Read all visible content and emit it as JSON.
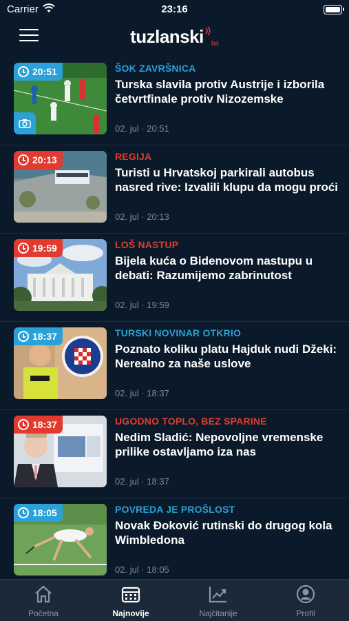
{
  "status_bar": {
    "carrier": "Carrier",
    "time": "23:16",
    "battery_level": 1.0
  },
  "header": {
    "logo_text": "tuzlanski",
    "logo_suffix": "ba",
    "menu_icon": "hamburger-menu-icon"
  },
  "colors": {
    "background": "#0b1a2a",
    "accent_blue": "#2aa1d8",
    "accent_red": "#e23a2e",
    "muted_text": "#7c8896",
    "tabbar_bg": "#1b2938"
  },
  "articles": [
    {
      "time": "20:51",
      "category": "ŠOK ZAVRŠNICA",
      "category_color": "#2aa1d8",
      "badge_color": "#2aa1d8",
      "title": "Turska slavila protiv Austrije i izborila četvrtfinale protiv Nizozemske",
      "meta": "02. jul · 20:51",
      "gallery": true
    },
    {
      "time": "20:13",
      "category": "REGIJA",
      "category_color": "#e23a2e",
      "badge_color": "#e23a2e",
      "title": "Turisti u Hrvatskoj parkirali autobus nasred rive: Izvalili klupu da mogu proći",
      "meta": "02. jul · 20:13",
      "gallery": false
    },
    {
      "time": "19:59",
      "category": "LOŠ NASTUP",
      "category_color": "#e23a2e",
      "badge_color": "#e23a2e",
      "title": "Bijela kuća o Bidenovom nastupu u debati: Razumijemo zabrinutost",
      "meta": "02. jul · 19:59",
      "gallery": false
    },
    {
      "time": "18:37",
      "category": "TURSKI NOVINAR OTKRIO",
      "category_color": "#2aa1d8",
      "badge_color": "#2aa1d8",
      "title": "Poznato koliku platu Hajduk nudi Džeki: Nerealno za naše uslove",
      "meta": "02. jul · 18:37",
      "gallery": false
    },
    {
      "time": "18:37",
      "category": "UGODNO TOPLO, BEZ SPARINE",
      "category_color": "#e23a2e",
      "badge_color": "#e23a2e",
      "title": "Nedim Sladić: Nepovoljne vremenske prilike ostavljamo iza nas",
      "meta": "02. jul · 18:37",
      "gallery": false
    },
    {
      "time": "18:05",
      "category": "POVREDA JE PROŠLOST",
      "category_color": "#2aa1d8",
      "badge_color": "#2aa1d8",
      "title": "Novak Đoković rutinski do drugog kola Wimbledona",
      "meta": "02. jul · 18:05",
      "gallery": false
    }
  ],
  "tabs": [
    {
      "label": "Početna",
      "icon": "home-icon",
      "active": false
    },
    {
      "label": "Najnovije",
      "icon": "calendar-icon",
      "active": true
    },
    {
      "label": "Najčitanije",
      "icon": "trending-chart-icon",
      "active": false
    },
    {
      "label": "Profil",
      "icon": "profile-icon",
      "active": false
    }
  ]
}
